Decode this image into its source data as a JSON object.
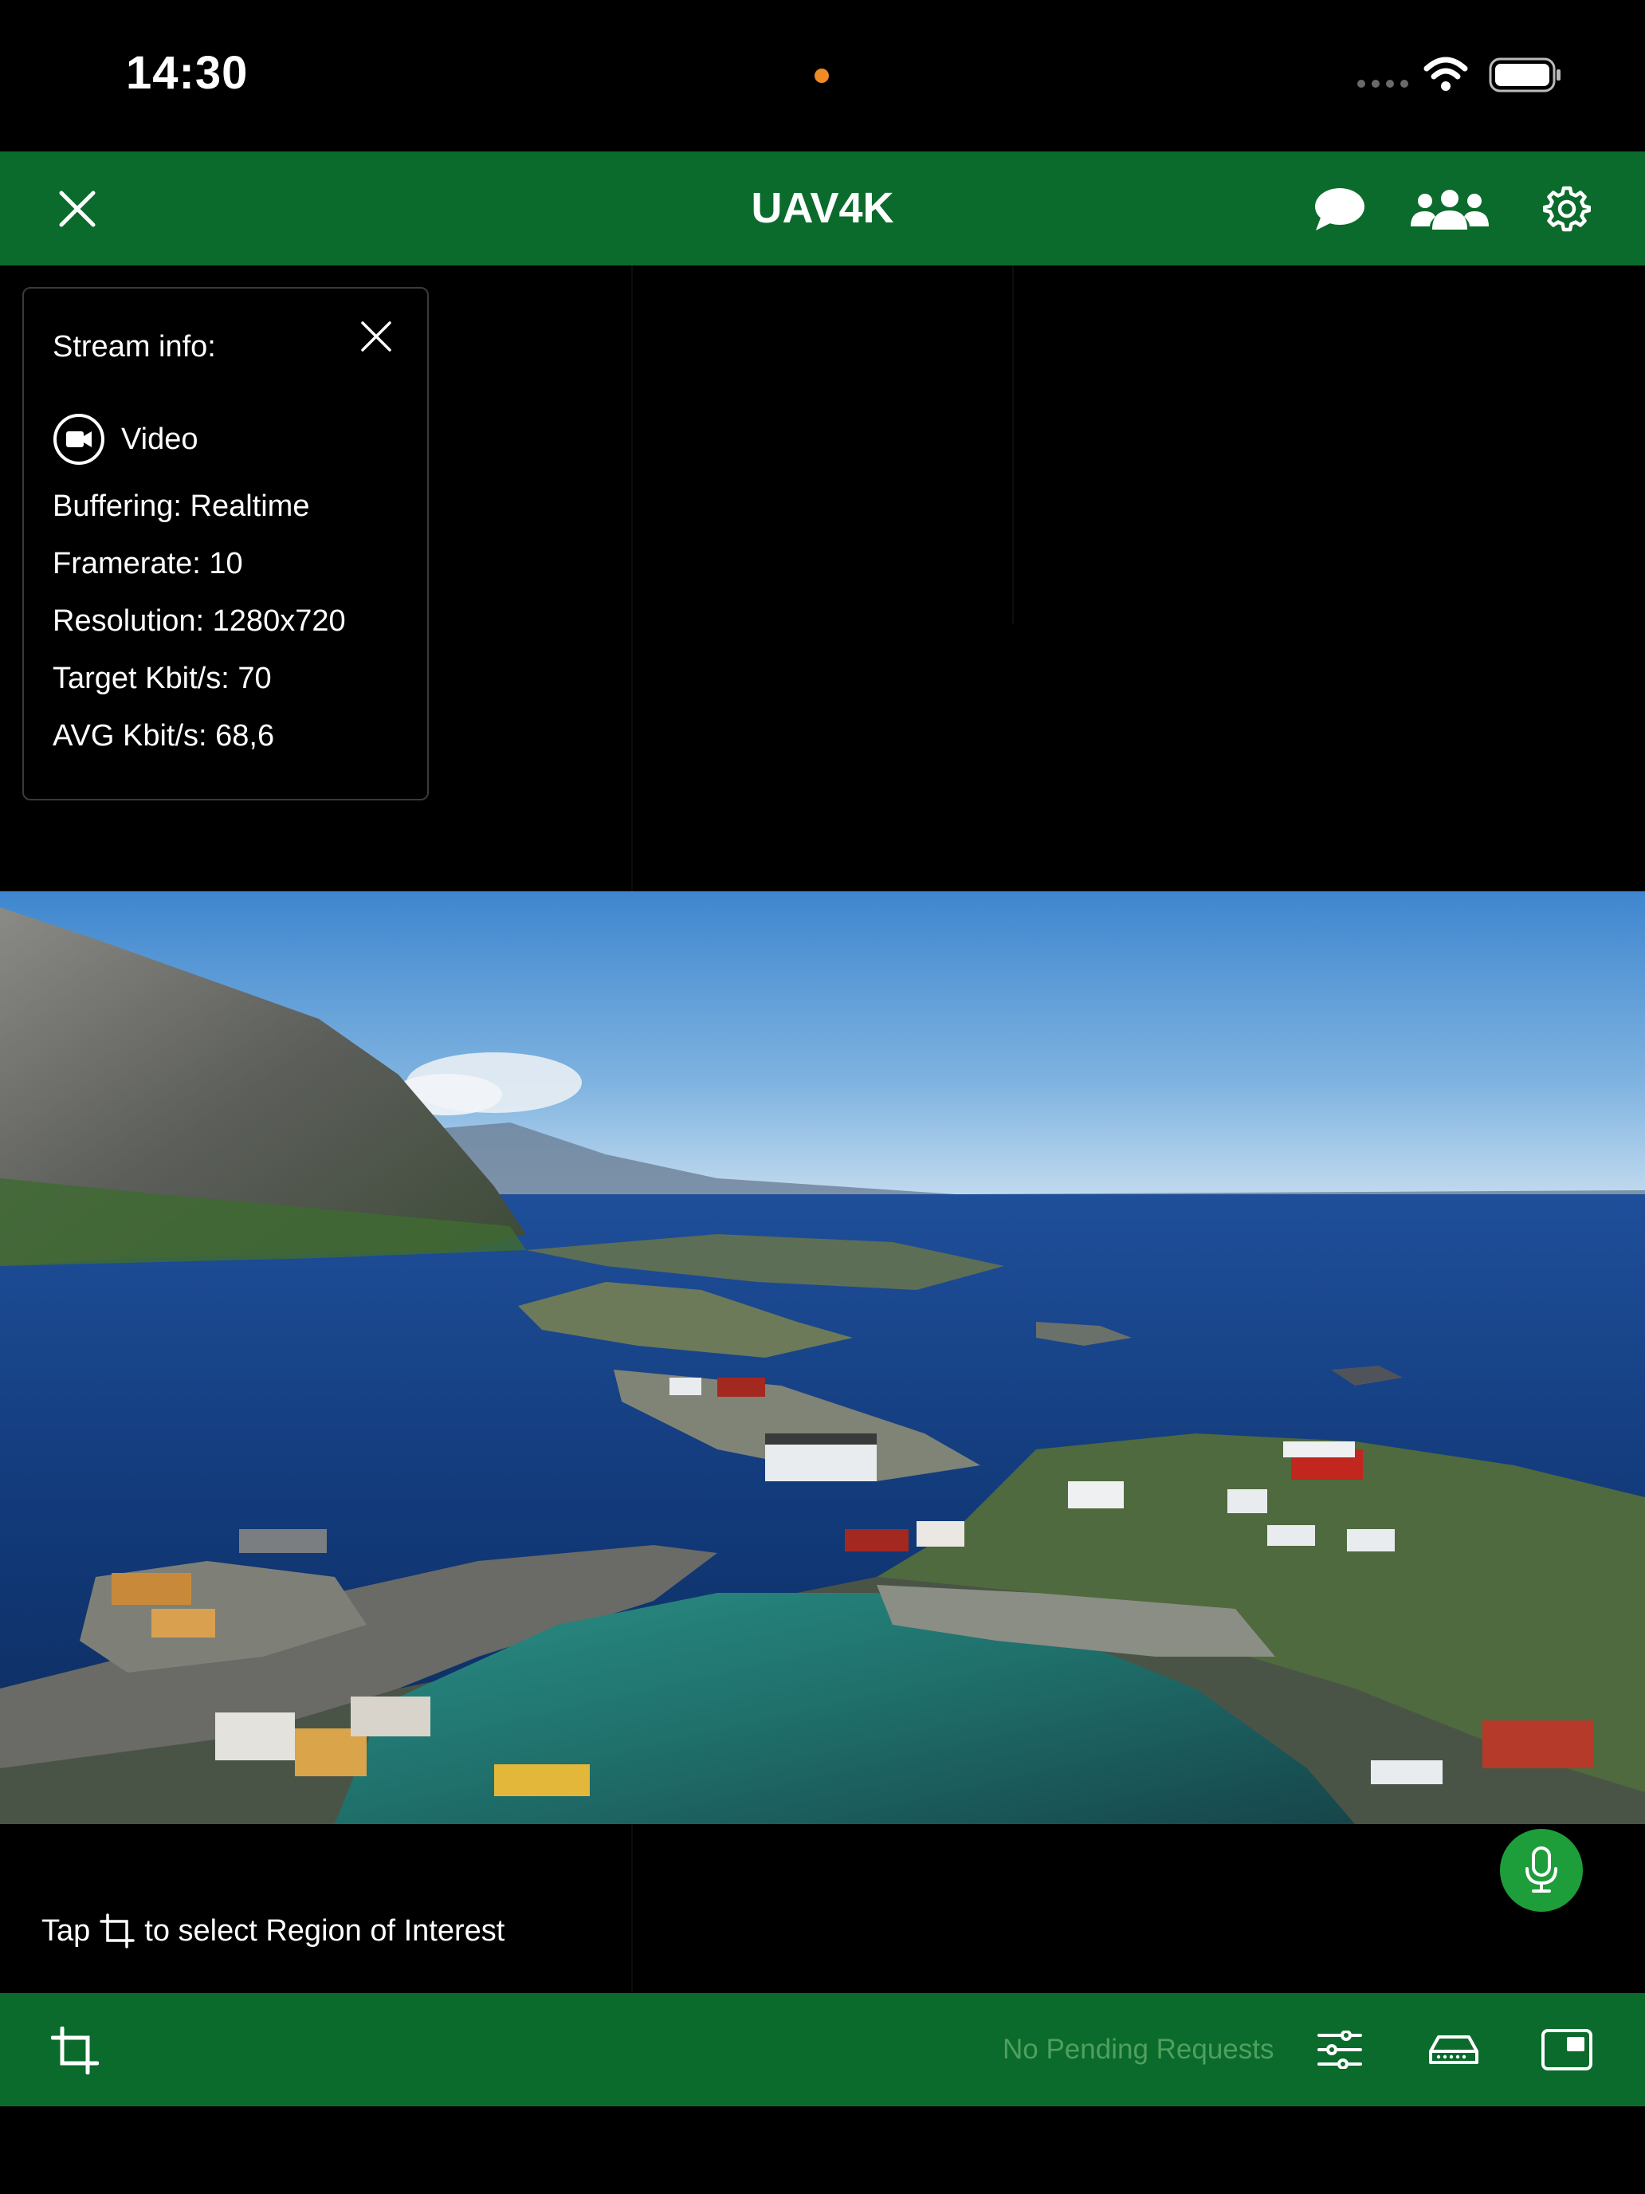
{
  "status_bar": {
    "time": "14:30",
    "recording_dot_color": "#f08a24"
  },
  "header": {
    "title": "UAV4K",
    "close_icon": "close-icon",
    "chat_icon": "chat-bubble-icon",
    "participants_icon": "group-icon",
    "settings_icon": "gear-icon"
  },
  "stream_info": {
    "title": "Stream info:",
    "media_type": "Video",
    "lines": [
      "Buffering: Realtime",
      "Framerate: 10",
      "Resolution: 1280x720",
      "Target Kbit/s: 70",
      "AVG Kbit/s: 68,6"
    ]
  },
  "roi_hint": {
    "prefix": "Tap",
    "suffix": "to select Region of Interest",
    "icon": "crop-icon"
  },
  "footer": {
    "pending_label": "No Pending Requests",
    "crop_icon": "crop-icon",
    "sliders_icon": "sliders-icon",
    "storage_icon": "storage-icon",
    "pip_icon": "picture-in-picture-icon"
  },
  "colors": {
    "accent_green": "#0b6b2c",
    "mic_green": "#1e9e3a",
    "pending_text": "#4fa05e"
  }
}
